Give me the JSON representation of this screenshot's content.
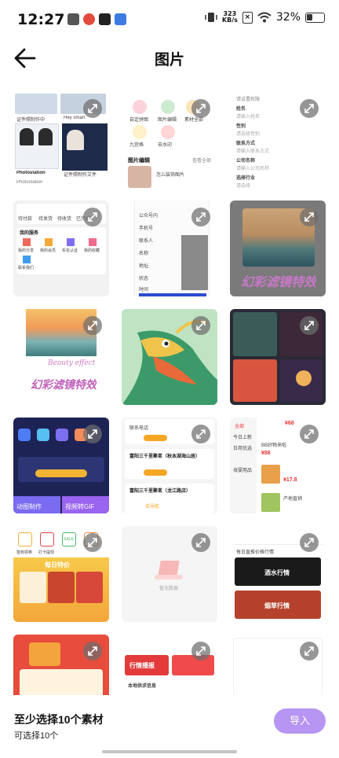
{
  "status_bar": {
    "time": "12:27",
    "net_speed_value": "323",
    "net_speed_unit": "KB/s",
    "battery": "32%"
  },
  "header": {
    "title": "图片"
  },
  "icons": {
    "back": "arrow-left-icon",
    "expand": "expand-icon"
  },
  "tiles": [
    {
      "texts": [
        "证件照制作中",
        "Hey smart",
        "Photostation",
        "证件照制作文件",
        "Photostation"
      ]
    },
    {
      "texts": [
        "自定拼图",
        "图片编辑",
        "素材全部",
        "九宫格",
        "去水印",
        "图片编辑",
        "查看全部",
        "怎么装饰图片"
      ]
    },
    {
      "texts": [
        "请设置权限",
        "姓名",
        "请输入姓名",
        "性别",
        "请选择性别",
        "联系方式",
        "请输入联系方式",
        "公司名称",
        "请输入公司名称",
        "选择行业",
        "请选择"
      ]
    },
    {
      "texts": [
        "待付款",
        "待发货",
        "待收货",
        "已完成",
        "我的服务",
        "我的分享",
        "我的会员",
        "实名认证",
        "我的收藏",
        "联系我们"
      ]
    },
    {
      "texts": [
        "公众号内",
        "手机号",
        "联系人",
        "名称",
        "地址",
        "状态",
        "时间"
      ]
    },
    {
      "texts": [
        "幻彩滤镜特效"
      ]
    },
    {
      "texts": [
        "Beauty effect",
        "幻彩滤镜特效"
      ]
    },
    {
      "texts": []
    },
    {
      "texts": []
    },
    {
      "texts": [
        "动图制作",
        "视频转GIF",
        "帮你制作",
        "动图GIF"
      ]
    },
    {
      "texts": [
        "联系电话",
        "富阳三千里聚茗（秋本湖海山居）",
        "富阳三千里聚茗（龙江路店）",
        "去导航"
      ]
    },
    {
      "texts": [
        "全部",
        "今日上新",
        "日用优选",
        "¥68",
        "BB好物来啦",
        "¥88",
        "母婴用品",
        "¥17.8",
        "产地直销"
      ]
    },
    {
      "texts": [
        "签到领券",
        "打卡提现",
        "SALE",
        "每日特价"
      ]
    },
    {
      "texts": [
        "暂无数据"
      ]
    },
    {
      "texts": [
        "每日直推价格行情",
        "酒水行情",
        "烟草行情"
      ]
    },
    {
      "texts": []
    },
    {
      "texts": [
        "行情播报",
        "本地供求信息"
      ]
    },
    {
      "texts": []
    }
  ],
  "bottom": {
    "main_text": "至少选择10个素材",
    "sub_text": "可选择10个",
    "import_label": "导入"
  }
}
